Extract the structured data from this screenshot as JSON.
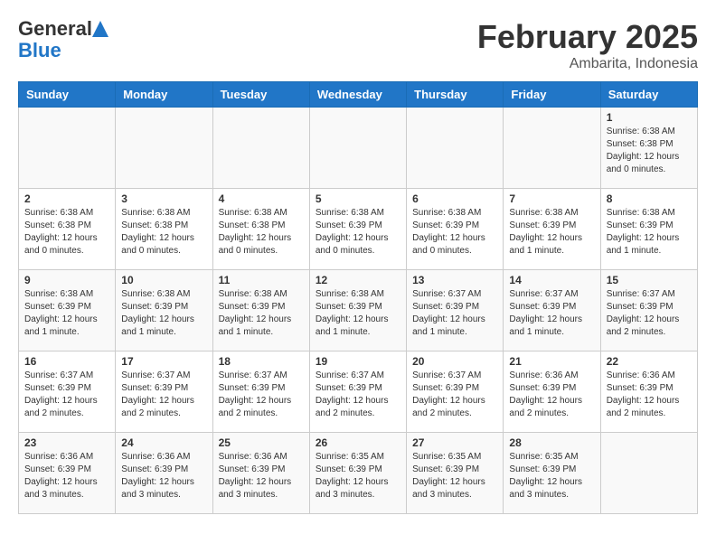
{
  "logo": {
    "line1": "General",
    "line2": "Blue"
  },
  "title": "February 2025",
  "location": "Ambarita, Indonesia",
  "days_of_week": [
    "Sunday",
    "Monday",
    "Tuesday",
    "Wednesday",
    "Thursday",
    "Friday",
    "Saturday"
  ],
  "weeks": [
    [
      {
        "day": "",
        "info": ""
      },
      {
        "day": "",
        "info": ""
      },
      {
        "day": "",
        "info": ""
      },
      {
        "day": "",
        "info": ""
      },
      {
        "day": "",
        "info": ""
      },
      {
        "day": "",
        "info": ""
      },
      {
        "day": "1",
        "info": "Sunrise: 6:38 AM\nSunset: 6:38 PM\nDaylight: 12 hours\nand 0 minutes."
      }
    ],
    [
      {
        "day": "2",
        "info": "Sunrise: 6:38 AM\nSunset: 6:38 PM\nDaylight: 12 hours\nand 0 minutes."
      },
      {
        "day": "3",
        "info": "Sunrise: 6:38 AM\nSunset: 6:38 PM\nDaylight: 12 hours\nand 0 minutes."
      },
      {
        "day": "4",
        "info": "Sunrise: 6:38 AM\nSunset: 6:38 PM\nDaylight: 12 hours\nand 0 minutes."
      },
      {
        "day": "5",
        "info": "Sunrise: 6:38 AM\nSunset: 6:39 PM\nDaylight: 12 hours\nand 0 minutes."
      },
      {
        "day": "6",
        "info": "Sunrise: 6:38 AM\nSunset: 6:39 PM\nDaylight: 12 hours\nand 0 minutes."
      },
      {
        "day": "7",
        "info": "Sunrise: 6:38 AM\nSunset: 6:39 PM\nDaylight: 12 hours\nand 1 minute."
      },
      {
        "day": "8",
        "info": "Sunrise: 6:38 AM\nSunset: 6:39 PM\nDaylight: 12 hours\nand 1 minute."
      }
    ],
    [
      {
        "day": "9",
        "info": "Sunrise: 6:38 AM\nSunset: 6:39 PM\nDaylight: 12 hours\nand 1 minute."
      },
      {
        "day": "10",
        "info": "Sunrise: 6:38 AM\nSunset: 6:39 PM\nDaylight: 12 hours\nand 1 minute."
      },
      {
        "day": "11",
        "info": "Sunrise: 6:38 AM\nSunset: 6:39 PM\nDaylight: 12 hours\nand 1 minute."
      },
      {
        "day": "12",
        "info": "Sunrise: 6:38 AM\nSunset: 6:39 PM\nDaylight: 12 hours\nand 1 minute."
      },
      {
        "day": "13",
        "info": "Sunrise: 6:37 AM\nSunset: 6:39 PM\nDaylight: 12 hours\nand 1 minute."
      },
      {
        "day": "14",
        "info": "Sunrise: 6:37 AM\nSunset: 6:39 PM\nDaylight: 12 hours\nand 1 minute."
      },
      {
        "day": "15",
        "info": "Sunrise: 6:37 AM\nSunset: 6:39 PM\nDaylight: 12 hours\nand 2 minutes."
      }
    ],
    [
      {
        "day": "16",
        "info": "Sunrise: 6:37 AM\nSunset: 6:39 PM\nDaylight: 12 hours\nand 2 minutes."
      },
      {
        "day": "17",
        "info": "Sunrise: 6:37 AM\nSunset: 6:39 PM\nDaylight: 12 hours\nand 2 minutes."
      },
      {
        "day": "18",
        "info": "Sunrise: 6:37 AM\nSunset: 6:39 PM\nDaylight: 12 hours\nand 2 minutes."
      },
      {
        "day": "19",
        "info": "Sunrise: 6:37 AM\nSunset: 6:39 PM\nDaylight: 12 hours\nand 2 minutes."
      },
      {
        "day": "20",
        "info": "Sunrise: 6:37 AM\nSunset: 6:39 PM\nDaylight: 12 hours\nand 2 minutes."
      },
      {
        "day": "21",
        "info": "Sunrise: 6:36 AM\nSunset: 6:39 PM\nDaylight: 12 hours\nand 2 minutes."
      },
      {
        "day": "22",
        "info": "Sunrise: 6:36 AM\nSunset: 6:39 PM\nDaylight: 12 hours\nand 2 minutes."
      }
    ],
    [
      {
        "day": "23",
        "info": "Sunrise: 6:36 AM\nSunset: 6:39 PM\nDaylight: 12 hours\nand 3 minutes."
      },
      {
        "day": "24",
        "info": "Sunrise: 6:36 AM\nSunset: 6:39 PM\nDaylight: 12 hours\nand 3 minutes."
      },
      {
        "day": "25",
        "info": "Sunrise: 6:36 AM\nSunset: 6:39 PM\nDaylight: 12 hours\nand 3 minutes."
      },
      {
        "day": "26",
        "info": "Sunrise: 6:35 AM\nSunset: 6:39 PM\nDaylight: 12 hours\nand 3 minutes."
      },
      {
        "day": "27",
        "info": "Sunrise: 6:35 AM\nSunset: 6:39 PM\nDaylight: 12 hours\nand 3 minutes."
      },
      {
        "day": "28",
        "info": "Sunrise: 6:35 AM\nSunset: 6:39 PM\nDaylight: 12 hours\nand 3 minutes."
      },
      {
        "day": "",
        "info": ""
      }
    ]
  ]
}
